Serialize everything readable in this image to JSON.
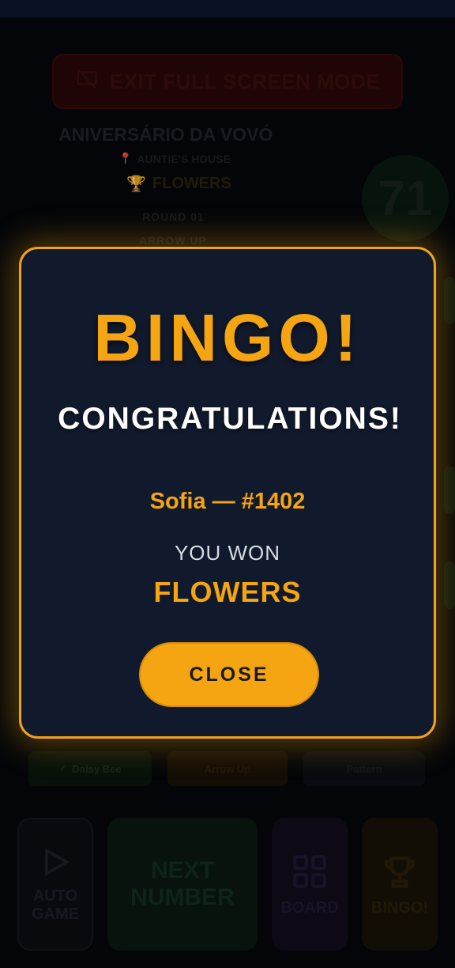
{
  "background": {
    "exit_button_label": "EXIT FULL SCREEN MODE",
    "event_title": "ANIVERSÁRIO DA VOVÓ",
    "location": "AUNTIE'S HOUSE",
    "prize": "FLOWERS",
    "round": "ROUND 01",
    "pattern": "ARROW UP",
    "current_number": "71",
    "chips": [
      "Daisy Bee",
      "Arrow Up",
      "Pattern"
    ],
    "controls": {
      "auto_game": "AUTO GAME",
      "next_number": "NEXT NUMBER",
      "board": "BOARD",
      "bingo": "BINGO!"
    }
  },
  "modal": {
    "title": "BINGO!",
    "congrats": "CONGRATULATIONS!",
    "winner": "Sofia — #1402",
    "you_won_label": "YOU WON",
    "prize": "FLOWERS",
    "close_label": "CLOSE"
  },
  "colors": {
    "accent": "#f5a412",
    "modal_bg": "#111a2c",
    "page_bg": "#05070b"
  }
}
